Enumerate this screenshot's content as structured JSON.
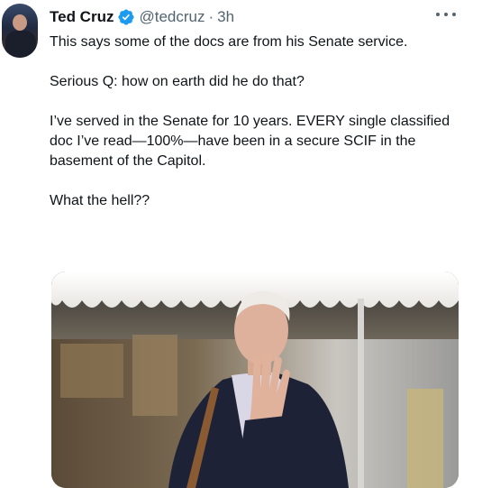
{
  "tweet": {
    "author": {
      "name": "Ted Cruz",
      "handle": "@tedcruz",
      "verified": true,
      "avatar_icon": "profile-avatar"
    },
    "separator": "·",
    "timestamp": "3h",
    "more_icon": "ellipsis-icon",
    "paragraphs": [
      "This says some of the docs are from his Senate service.",
      "Serious Q: how on earth did he do that?",
      "I’ve served in the Senate for 10 years. EVERY single classified doc I’ve read—100%—have been in a secure SCIF in the basement of the Capitol.",
      "What the hell??"
    ],
    "media": {
      "type": "photo"
    }
  },
  "colors": {
    "verified_badge": "#1d9bf0",
    "secondary_text": "#536471",
    "primary_text": "#0f1419"
  }
}
